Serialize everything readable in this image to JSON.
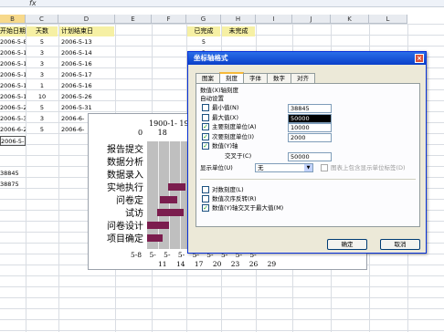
{
  "formula_bar": {
    "fx": "fx"
  },
  "columns": [
    "B",
    "C",
    "D",
    "E",
    "F",
    "G",
    "H",
    "I",
    "J",
    "K",
    "L"
  ],
  "sheet": {
    "headers": {
      "start": "开始日期",
      "days": "天数",
      "end": "计划结束日",
      "done": "已完成",
      "undone": "未完成"
    },
    "rows": [
      {
        "start": "2006-5-8",
        "days": "5",
        "end": "2006-5-13",
        "done": "5"
      },
      {
        "start": "2006-5-11",
        "days": "3",
        "end": "2006-5-14",
        "done": "3"
      },
      {
        "start": "2006-5-13",
        "days": "3",
        "end": "2006-5-16",
        "done": "3"
      },
      {
        "start": "2006-5-14",
        "days": "3",
        "end": "2006-5-17",
        "done": "3"
      },
      {
        "start": "2006-5-15",
        "days": "1",
        "end": "2006-5-16",
        "done": "1"
      },
      {
        "start": "2006-5-16",
        "days": "10",
        "end": "2006-5-26",
        "done": ""
      },
      {
        "start": "2006-5-26",
        "days": "5",
        "end": "2006-5-31",
        "done": ""
      },
      {
        "start": "2006-5-30",
        "days": "3",
        "end": "2006-6-",
        "done": ""
      },
      {
        "start": "2006-6-2",
        "days": "5",
        "end": "2006-6-",
        "done": ""
      }
    ],
    "extra": [
      "2006-5-16",
      "38845",
      "38875"
    ]
  },
  "chart": {
    "top_ticks_1": "1900-1-  1927-",
    "top_ticks_2": [
      "0",
      "18"
    ],
    "tasks": [
      "报告提交",
      "数据分析",
      "数据录入",
      "实地执行",
      "问卷定",
      "试访",
      "问卷设计",
      "项目确定"
    ],
    "x_ticks_1": [
      "5-8",
      "5-",
      "5-",
      "5-",
      "5-",
      "5-",
      "5-",
      "5-",
      "5-"
    ],
    "x_ticks_2": [
      "11",
      "14",
      "17",
      "20",
      "23",
      "26",
      "29"
    ],
    "bar_color": "#7b1d4e",
    "bar_values": [
      {
        "start": 0.0,
        "width": 0.0
      },
      {
        "start": 0.0,
        "width": 0.0
      },
      {
        "start": 0.0,
        "width": 0.0
      },
      {
        "start": 0.47,
        "width": 0.4
      },
      {
        "start": 0.3,
        "width": 0.38
      },
      {
        "start": 0.22,
        "width": 0.62
      },
      {
        "start": 0.0,
        "width": 0.5
      },
      {
        "start": 0.0,
        "width": 0.35
      }
    ]
  },
  "dialog": {
    "title": "坐标轴格式",
    "close": "×",
    "tabs": [
      "图案",
      "刻度",
      "字体",
      "数字",
      "对齐"
    ],
    "active_tab": 1,
    "section_title": "数值(X)轴刻度",
    "auto_label": "自动设置",
    "rows": [
      {
        "label": "最小值(N)",
        "checked": false,
        "value": "38845",
        "selected": false
      },
      {
        "label": "最大值(X)",
        "checked": false,
        "value": "50000",
        "selected": true
      },
      {
        "label": "主要刻度单位(A)",
        "checked": true,
        "value": "10000",
        "selected": false
      },
      {
        "label": "次要刻度单位(I)",
        "checked": true,
        "value": "2000",
        "selected": false
      },
      {
        "label": "数值(Y)轴",
        "checked": true,
        "value": "",
        "selected": false
      },
      {
        "label": "交叉于(C)",
        "checked": false,
        "value": "50000",
        "selected": false
      }
    ],
    "display_units_label": "显示单位(U)",
    "display_units_value": "无",
    "show_units_label": "图表上包含显示单位标签(D)",
    "log_label": "对数刻度(L)",
    "reverse_label": "数值次序反转(R)",
    "cross_max_label": "数值(Y)轴交叉于最大值(M)",
    "ok": "确定",
    "cancel": "取消"
  }
}
